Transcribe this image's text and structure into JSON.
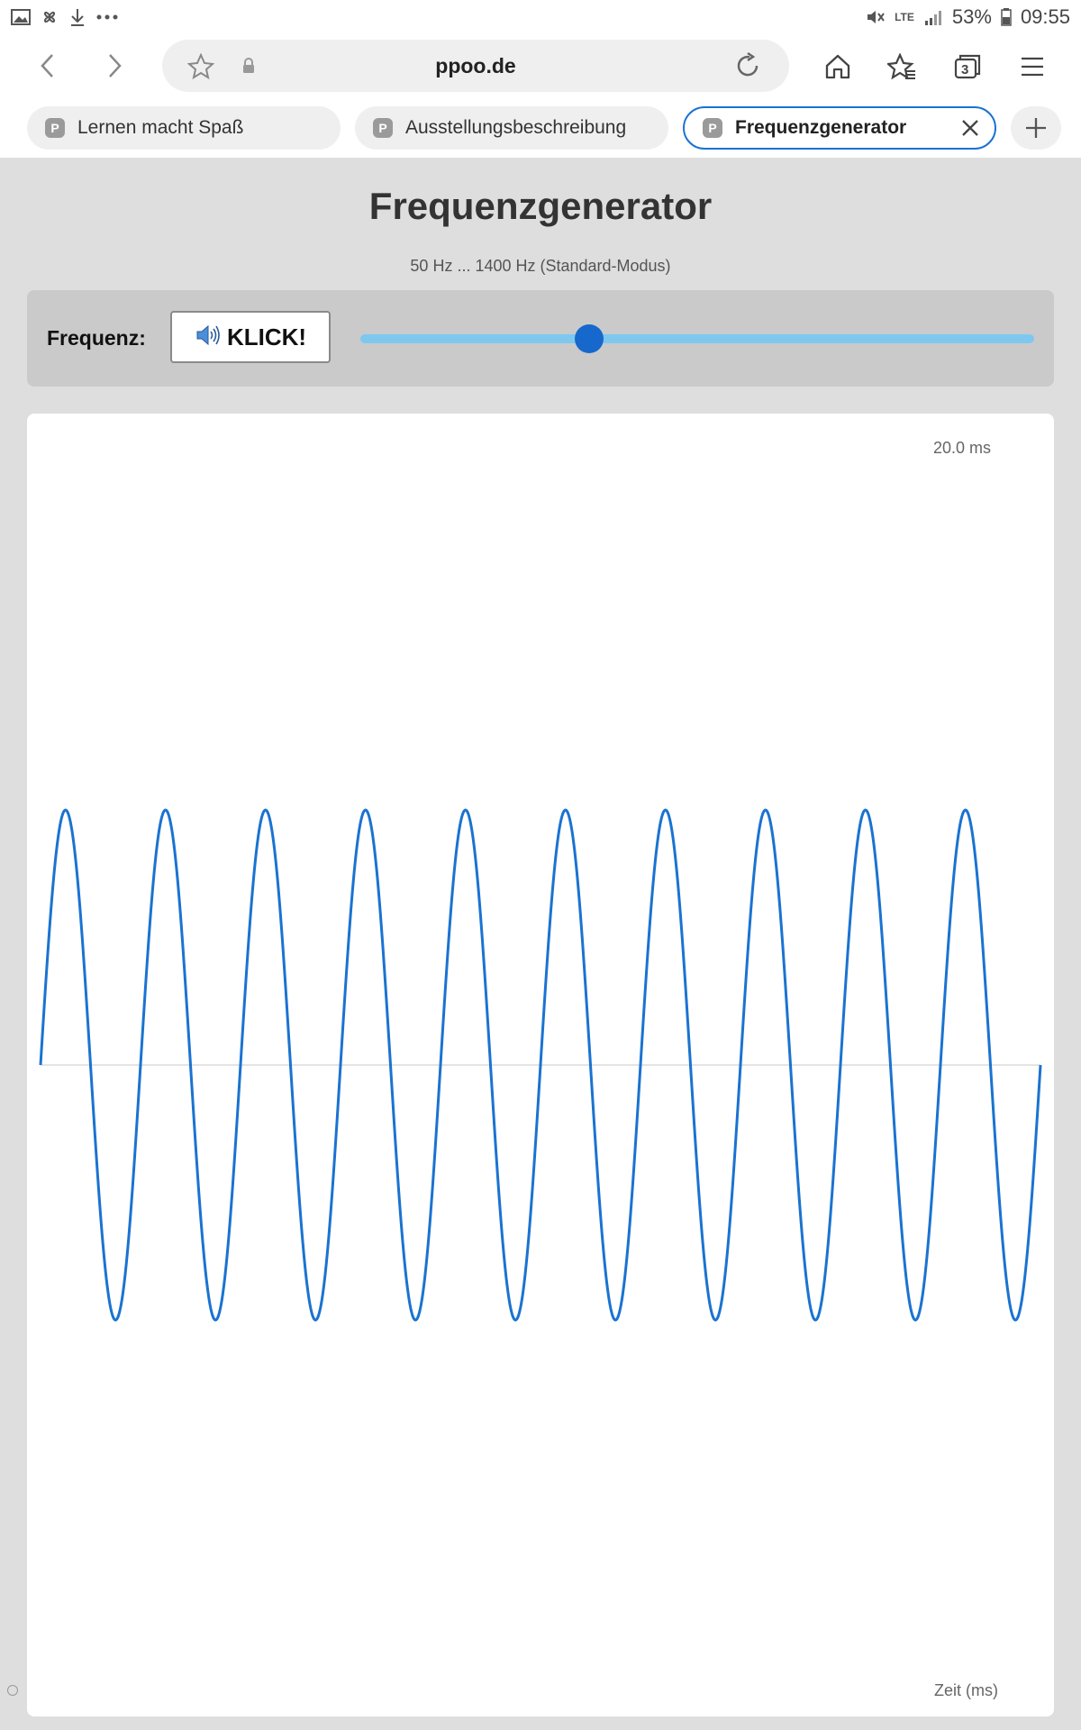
{
  "statusbar": {
    "battery": "53%",
    "time": "09:55",
    "network": "LTE",
    "icons": [
      "gallery-icon",
      "pinwheel-icon",
      "download-icon",
      "more-icon",
      "mute-icon",
      "signal-icon",
      "battery-icon"
    ]
  },
  "browser": {
    "url": "ppoo.de",
    "tab_count": "3",
    "tabs": [
      {
        "favicon": "P",
        "label": "Lernen macht Spaß",
        "active": false
      },
      {
        "favicon": "P",
        "label": "Ausstellungsbeschreibung",
        "active": false
      },
      {
        "favicon": "P",
        "label": "Frequenzgenerator",
        "active": true
      }
    ]
  },
  "page": {
    "title": "Frequenzgenerator",
    "subtitle": "50 Hz ... 1400 Hz (Standard-Modus)",
    "frequency_label": "Frequenz:",
    "button_label": "KLICK!",
    "slider_value_fraction": 0.34
  },
  "chart_data": {
    "type": "line",
    "time_window_label": "20.0 ms",
    "xlabel": "Zeit (ms)",
    "time_window_ms": 20.0,
    "cycles": 10,
    "waveform": "sine",
    "color": "#1a73d0",
    "grid": false,
    "zero_line": true
  }
}
